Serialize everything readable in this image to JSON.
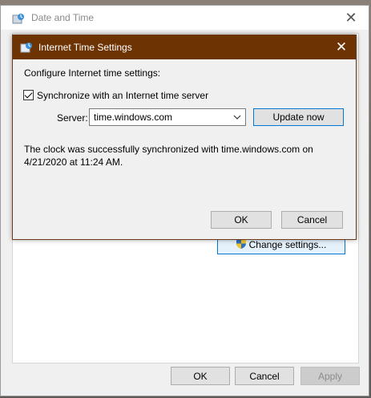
{
  "outer_window": {
    "title": "Date and Time",
    "change_settings_label": "Change settings...",
    "buttons": {
      "ok": "OK",
      "cancel": "Cancel",
      "apply": "Apply"
    }
  },
  "dialog": {
    "title": "Internet Time Settings",
    "heading": "Configure Internet time settings:",
    "sync_checkbox": {
      "label": "Synchronize with an Internet time server",
      "checked": true
    },
    "server_label": "Server:",
    "server_value": "time.windows.com",
    "update_button": "Update now",
    "status_line1": "The clock was successfully synchronized with time.windows.com on",
    "status_line2": "4/21/2020 at 11:24 AM.",
    "ok_button": "OK",
    "cancel_button": "Cancel"
  },
  "colors": {
    "dialog_titlebar": "#6e3303",
    "focus_border": "#0078d7"
  }
}
